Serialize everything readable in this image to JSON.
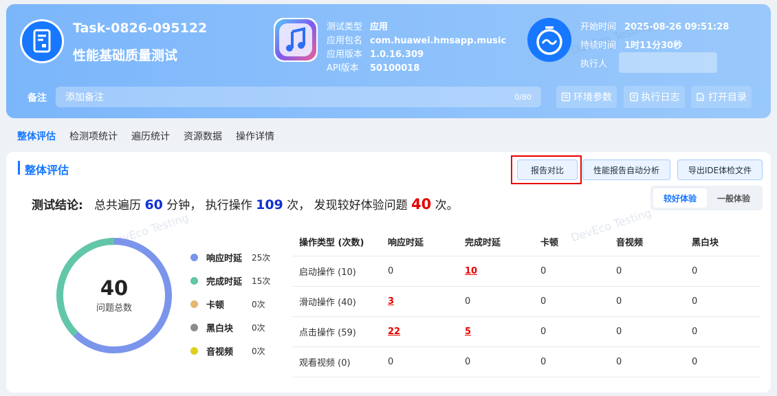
{
  "header": {
    "task_id": "Task-0826-095122",
    "task_name": "性能基础质量测试",
    "test_type_label": "测试类型",
    "test_type_value": "应用",
    "package_label": "应用包名",
    "package_value": "com.huawei.hmsapp.music",
    "version_label": "应用版本",
    "version_value": "1.0.16.309",
    "api_label": "API版本",
    "api_value": "50100018",
    "start_label": "开始时间",
    "start_value": "2025-08-26 09:51:28",
    "duration_label": "持续时间",
    "duration_value": "1时11分30秒",
    "executor_label": "执行人",
    "note_label": "备注",
    "note_placeholder": "添加备注",
    "note_count": "0/80",
    "env_button": "环境参数",
    "log_button": "执行日志",
    "dir_button": "打开目录"
  },
  "watermark": "DevEco Testing",
  "tabs": [
    "整体评估",
    "检测项统计",
    "遍历统计",
    "资源数据",
    "操作详情"
  ],
  "section_title": "整体评估",
  "actions": {
    "compare": "报告对比",
    "auto_analysis": "性能报告自动分析",
    "export_ide": "导出IDE体检文件"
  },
  "segment": {
    "good": "较好体验",
    "normal": "一般体验"
  },
  "conclusion": {
    "label": "测试结论:",
    "p1": "总共遍历",
    "minutes": "60",
    "p2": "分钟，",
    "p3": "执行操作",
    "ops": "109",
    "p4": "次，",
    "p5": "发现较好体验问题",
    "issues": "40",
    "p6": "次。"
  },
  "donut": {
    "total": "40",
    "total_label": "问题总数"
  },
  "legend": [
    {
      "name": "响应时延",
      "count": "25次",
      "color": "#7b95ec",
      "value": 25
    },
    {
      "name": "完成时延",
      "count": "15次",
      "color": "#62c6a8",
      "value": 15
    },
    {
      "name": "卡顿",
      "count": "0次",
      "color": "#e4b672",
      "value": 0
    },
    {
      "name": "黑白块",
      "count": "0次",
      "color": "#8c8c8c",
      "value": 0
    },
    {
      "name": "音视频",
      "count": "0次",
      "color": "#e0cf1a",
      "value": 0
    }
  ],
  "table": {
    "headers": [
      "操作类型 (次数)",
      "响应时延",
      "完成时延",
      "卡顿",
      "音视频",
      "黑白块"
    ],
    "rows": [
      [
        "启动操作 (10)",
        "0",
        "10",
        "0",
        "0",
        "0"
      ],
      [
        "滑动操作 (40)",
        "3",
        "0",
        "0",
        "0",
        "0"
      ],
      [
        "点击操作 (59)",
        "22",
        "5",
        "0",
        "0",
        "0"
      ],
      [
        "观看视频 (0)",
        "0",
        "0",
        "0",
        "0",
        "0"
      ]
    ]
  },
  "colors": {
    "accent": "#1677ff",
    "alert": "#e80000",
    "header_bg": "#8cc0fb"
  }
}
